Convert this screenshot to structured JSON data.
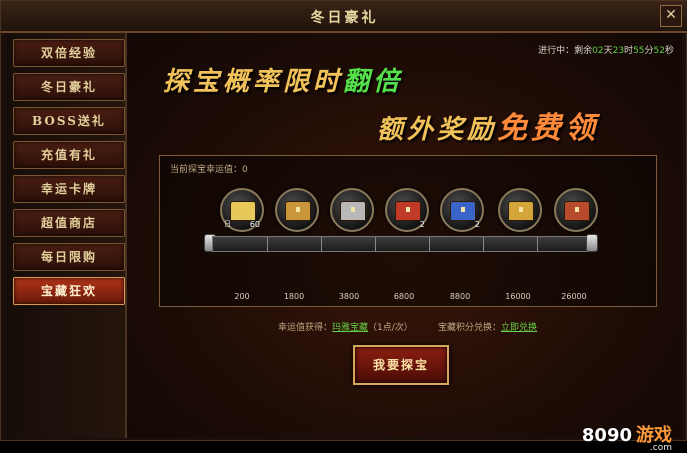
{
  "window": {
    "title": "冬日豪礼",
    "close_label": "✕"
  },
  "sidebar": {
    "items": [
      {
        "label": "双倍经验",
        "active": false
      },
      {
        "label": "冬日豪礼",
        "active": false
      },
      {
        "label": "BOSS送礼",
        "active": false
      },
      {
        "label": "充值有礼",
        "active": false
      },
      {
        "label": "幸运卡牌",
        "active": false
      },
      {
        "label": "超值商店",
        "active": false
      },
      {
        "label": "每日限购",
        "active": false
      },
      {
        "label": "宝藏狂欢",
        "active": true
      }
    ]
  },
  "countdown": {
    "prefix": "进行中：剩余",
    "days": "02",
    "days_unit": "天",
    "hours": "23",
    "hours_unit": "时",
    "minutes": "55",
    "minutes_unit": "分",
    "seconds": "52",
    "seconds_unit": "秒"
  },
  "banner": {
    "line1": "探宝概率限时",
    "line1_highlight": "翻倍",
    "line2": "额外奖励",
    "line2_highlight": "免费领"
  },
  "panel": {
    "luck_label": "当前探宝幸运值：",
    "luck_value": "0",
    "rewards": [
      {
        "icon": "gold-ingot-icon",
        "qty": "60",
        "tag": "日",
        "color": "#e7c95a"
      },
      {
        "icon": "gold-chest-icon",
        "qty": "",
        "tag": "",
        "color": "#c9963a"
      },
      {
        "icon": "silver-chest-icon",
        "qty": "",
        "tag": "",
        "color": "#b8b8b8"
      },
      {
        "icon": "red-chest-icon",
        "qty": "2",
        "tag": "",
        "color": "#c03a2a"
      },
      {
        "icon": "blue-chest-icon",
        "qty": "2",
        "tag": "",
        "color": "#3a64c8"
      },
      {
        "icon": "gold-chest-icon",
        "qty": "",
        "tag": "",
        "color": "#d4a63a"
      },
      {
        "icon": "red-gold-chest-icon",
        "qty": "",
        "tag": "",
        "color": "#b84a2e"
      }
    ],
    "milestones": [
      "200",
      "1800",
      "3800",
      "6800",
      "8800",
      "16000",
      "26000"
    ],
    "progress_fraction": 0,
    "luck_gain_label": "幸运值获得：",
    "luck_gain_link": "玛雅宝藏",
    "luck_gain_rate": "（1点/次）",
    "exchange_label": "宝藏积分兑换：",
    "exchange_link": "立即兑换"
  },
  "explore_button": "我要探宝",
  "watermark": {
    "brand": "8090",
    "cn": "游戏",
    "site": ".com"
  },
  "colors": {
    "accent_green": "#66d04a",
    "accent_gold": "#f2c25a",
    "active_tab": "#b03418"
  }
}
